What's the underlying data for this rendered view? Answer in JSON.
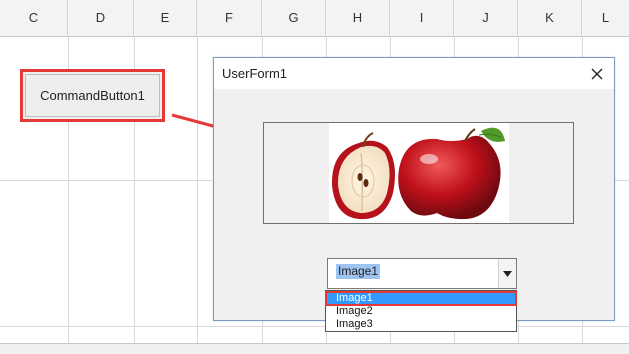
{
  "columns": [
    "C",
    "D",
    "E",
    "F",
    "G",
    "H",
    "I",
    "J",
    "K",
    "L"
  ],
  "command_button": {
    "label": "CommandButton1"
  },
  "userform": {
    "title": "UserForm1",
    "combo_value": "Image1",
    "dropdown_options": [
      "Image1",
      "Image2",
      "Image3"
    ],
    "selected_option": "Image1"
  },
  "colors": {
    "highlight": "#e53935",
    "selection": "#3399ff",
    "combo_selection": "#9dc3f0"
  },
  "icons": {
    "close": "close-icon",
    "combo_arrow": "chevron-down-icon",
    "arrow": "arrow-right-icon"
  }
}
